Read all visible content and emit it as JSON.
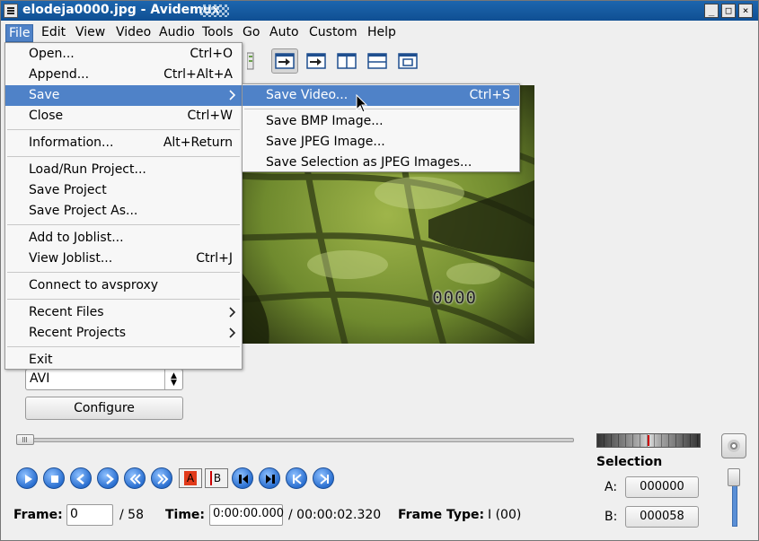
{
  "window": {
    "title": "elodeja0000.jpg - Avidemux",
    "controls": [
      "_",
      "□",
      "×"
    ]
  },
  "menubar": [
    "File",
    "Edit",
    "View",
    "Video",
    "Audio",
    "Tools",
    "Go",
    "Auto",
    "Custom",
    "Help"
  ],
  "file_menu": {
    "items": [
      {
        "label": "Open...",
        "accel": "Ctrl+O"
      },
      {
        "label": "Append...",
        "accel": "Ctrl+Alt+A"
      },
      {
        "label": "Save",
        "accel": ""
      },
      {
        "label": "Close",
        "accel": "Ctrl+W"
      },
      {
        "label": "Information...",
        "accel": "Alt+Return"
      },
      {
        "label": "Load/Run Project...",
        "accel": ""
      },
      {
        "label": "Save Project",
        "accel": ""
      },
      {
        "label": "Save Project As...",
        "accel": ""
      },
      {
        "label": "Add to Joblist...",
        "accel": ""
      },
      {
        "label": "View Joblist...",
        "accel": "Ctrl+J"
      },
      {
        "label": "Connect to avsproxy",
        "accel": ""
      },
      {
        "label": "Recent Files",
        "accel": ""
      },
      {
        "label": "Recent Projects",
        "accel": ""
      },
      {
        "label": "Exit",
        "accel": ""
      }
    ]
  },
  "save_submenu": {
    "items": [
      {
        "label": "Save Video...",
        "accel": "Ctrl+S"
      },
      {
        "label": "Save BMP Image...",
        "accel": ""
      },
      {
        "label": "Save JPEG Image...",
        "accel": ""
      },
      {
        "label": "Save Selection as JPEG Images...",
        "accel": ""
      }
    ]
  },
  "video": {
    "overlay_counter": "0000"
  },
  "output": {
    "format": "AVI",
    "configure_label": "Configure"
  },
  "selection": {
    "title": "Selection",
    "a_label": "A:",
    "a_value": "000000",
    "b_label": "B:",
    "b_value": "000058"
  },
  "status": {
    "frame_label": "Frame:",
    "frame_value": "0",
    "frame_total": "/ 58",
    "time_label": "Time:",
    "time_value": "0:00:00.000",
    "time_total": "/ 00:00:02.320",
    "frame_type_label": "Frame Type:",
    "frame_type_value": "I (00)"
  },
  "nav_marker_labels": {
    "a": "A",
    "b": "B"
  },
  "icons": [
    "play-icon",
    "stop-icon",
    "prev-frame-icon",
    "next-frame-icon",
    "rewind-icon",
    "fast-forward-icon",
    "set-marker-a-icon",
    "set-marker-b-icon",
    "prev-keyframe-icon",
    "next-keyframe-icon",
    "goto-start-icon",
    "goto-end-icon",
    "submenu-arrow-icon",
    "mouse-cursor-icon",
    "jog-wheel-icon"
  ],
  "colors": {
    "highlight": "#4f82c8",
    "titlebar": "#1d66ae",
    "marker_red": "#cc0000"
  }
}
